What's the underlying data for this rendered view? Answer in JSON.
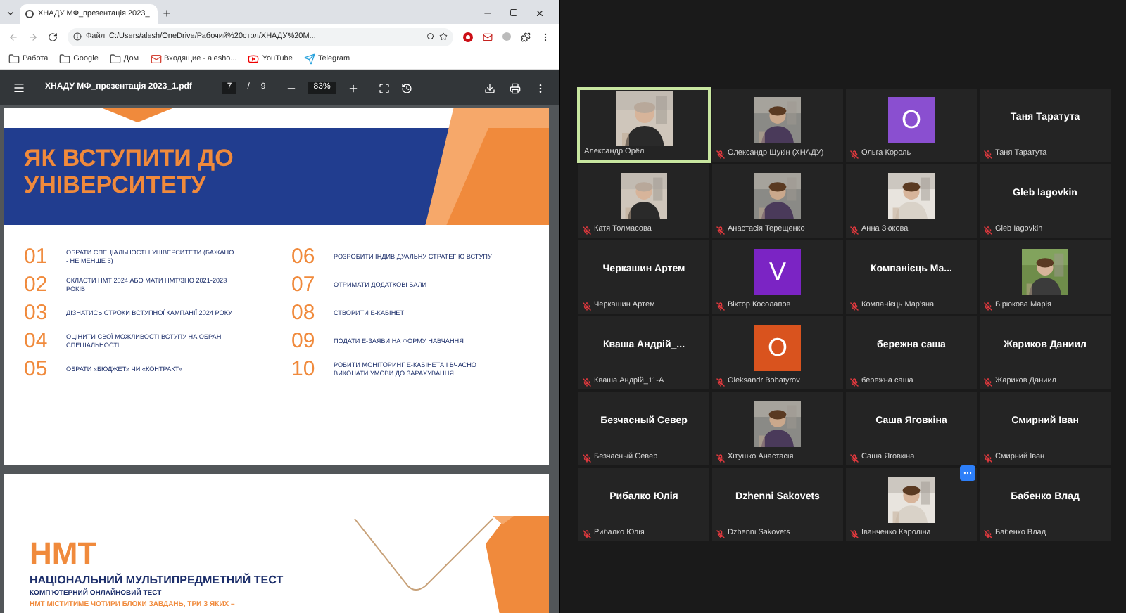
{
  "browser": {
    "tab_title": "ХНАДУ МФ_презентація 2023_",
    "address_scheme": "Файл",
    "address": "C:/Users/alesh/OneDrive/Рабочий%20стол/ХНАДУ%20M...",
    "bookmarks": [
      {
        "kind": "folder",
        "label": "Работа"
      },
      {
        "kind": "folder",
        "label": "Google"
      },
      {
        "kind": "folder",
        "label": "Дом"
      },
      {
        "kind": "mail",
        "label": "Входящие - aleshо..."
      },
      {
        "kind": "video",
        "label": "YouTube"
      },
      {
        "kind": "chat",
        "label": "Telegram"
      }
    ]
  },
  "pdf": {
    "file_name": "ХНАДУ МФ_презентація 2023_1.pdf",
    "page": "7",
    "page_separator": "/",
    "page_count": "9",
    "zoom": "83%",
    "slide1": {
      "title_lines": [
        "ЯК ВСТУПИТИ ДО",
        "УНІВЕРСИТЕТУ"
      ],
      "steps": [
        {
          "number": "01",
          "text": "ОБРАТИ СПЕЦІАЛЬНОСТІ І УНІВЕРСИТЕТИ (БАЖАНО - НЕ МЕНШЕ 5)"
        },
        {
          "number": "02",
          "text": "СКЛАСТИ НМТ 2024 АБО МАТИ НМТ/ЗНО 2021-2023 РОКІВ"
        },
        {
          "number": "03",
          "text": "ДІЗНАТИСЬ СТРОКИ ВСТУПНОЇ КАМПАНІЇ 2024 РОКУ"
        },
        {
          "number": "04",
          "text": "ОЦІНИТИ СВОЇ МОЖЛИВОСТІ ВСТУПУ НА ОБРАНІ СПЕЦІАЛЬНОСТІ"
        },
        {
          "number": "05",
          "text": "ОБРАТИ «БЮДЖЕТ» ЧИ «КОНТРАКТ»"
        },
        {
          "number": "06",
          "text": "РОЗРОБИТИ ІНДИВІДУАЛЬНУ СТРАТЕГІЮ ВСТУПУ"
        },
        {
          "number": "07",
          "text": "ОТРИМАТИ ДОДАТКОВІ БАЛИ"
        },
        {
          "number": "08",
          "text": "СТВОРИТИ Е-КАБІНЕТ"
        },
        {
          "number": "09",
          "text": "ПОДАТИ Е-ЗАЯВИ НА ФОРМУ НАВЧАННЯ"
        },
        {
          "number": "10",
          "text": "РОБИТИ МОНІТОРИНГ Е-КАБІНЕТА І ВЧАСНО ВИКОНАТИ УМОВИ ДО ЗАРАХУВАННЯ"
        }
      ]
    },
    "slide2": {
      "heading": "НМТ",
      "subtitle": "НАЦІОНАЛЬНИЙ МУЛЬТИПРЕДМЕТНИЙ ТЕСТ",
      "caption": "КОМП'ЮТЕРНИЙ ОНЛАЙНОВИЙ ТЕСТ",
      "body": "НМТ МІСТИТИМЕ ЧОТИРИ БЛОКИ ЗАВДАНЬ, ТРИ З ЯКИХ –"
    }
  },
  "participants": [
    {
      "kind": "video",
      "label": "Александр Орёл",
      "muted": false,
      "speaking": true
    },
    {
      "kind": "video",
      "label": "Олександр Щукін (ХНАДУ)",
      "muted": true,
      "speaking": false
    },
    {
      "kind": "avatar",
      "letter": "O",
      "color": "#8a4fd0",
      "label": "Ольга Король",
      "muted": true,
      "speaking": false
    },
    {
      "kind": "name",
      "display_name": "Таня Таратута",
      "label": "Таня Таратута",
      "muted": true,
      "speaking": false
    },
    {
      "kind": "video",
      "label": "Катя Толмасова",
      "muted": true,
      "speaking": false
    },
    {
      "kind": "video",
      "label": "Анастасія Терещенко",
      "muted": true,
      "speaking": false
    },
    {
      "kind": "video",
      "label": "Анна Зюкова",
      "muted": true,
      "speaking": false
    },
    {
      "kind": "name",
      "display_name": "Gleb Iagovkin",
      "label": "Gleb Iagovkin",
      "muted": true,
      "speaking": false
    },
    {
      "kind": "name",
      "display_name": "Черкашин Артем",
      "label": "Черкашин Артем",
      "muted": true,
      "speaking": false
    },
    {
      "kind": "avatar",
      "letter": "V",
      "color": "#7b24c4",
      "label": "Віктор  Косолапов",
      "muted": true,
      "speaking": false
    },
    {
      "kind": "name",
      "display_name": "Компанієць Ма...",
      "label": "Компанієць Мар'яна",
      "muted": true,
      "speaking": false
    },
    {
      "kind": "video",
      "label": "Бірюкова Марія",
      "muted": true,
      "speaking": false
    },
    {
      "kind": "name",
      "display_name": "Кваша Андрій_...",
      "label": "Кваша Андрій_11-А",
      "muted": true,
      "speaking": false
    },
    {
      "kind": "avatar",
      "letter": "O",
      "color": "#d9531e",
      "label": "Oleksandr Bohatyrov",
      "muted": true,
      "speaking": false
    },
    {
      "kind": "name",
      "display_name": "бережна саша",
      "label": "бережна саша",
      "muted": true,
      "speaking": false
    },
    {
      "kind": "name",
      "display_name": "Жариков Даниил",
      "label": "Жариков Даниил",
      "muted": true,
      "speaking": false
    },
    {
      "kind": "name",
      "display_name": "Безчасный Север",
      "label": "Безчасный Север",
      "muted": true,
      "speaking": false
    },
    {
      "kind": "video",
      "label": "Хітушко Анастасія",
      "muted": true,
      "speaking": false
    },
    {
      "kind": "name",
      "display_name": "Саша Яговкіна",
      "label": "Саша Яговкіна",
      "muted": true,
      "speaking": false
    },
    {
      "kind": "name",
      "display_name": "Смирний Іван",
      "label": "Смирний Іван",
      "muted": true,
      "speaking": false
    },
    {
      "kind": "name",
      "display_name": "Рибалко Юлія",
      "label": "Рибалко Юлія",
      "muted": true,
      "speaking": false
    },
    {
      "kind": "name",
      "display_name": "Dzhenni Sakovets",
      "label": "Dzhenni Sakovets",
      "muted": true,
      "speaking": false
    },
    {
      "kind": "video",
      "label": "Іванченко Кароліна",
      "muted": true,
      "speaking": false,
      "more_button": true
    },
    {
      "kind": "name",
      "display_name": "Бабенко Влад",
      "label": "Бабенко Влад",
      "muted": true,
      "speaking": false
    }
  ]
}
